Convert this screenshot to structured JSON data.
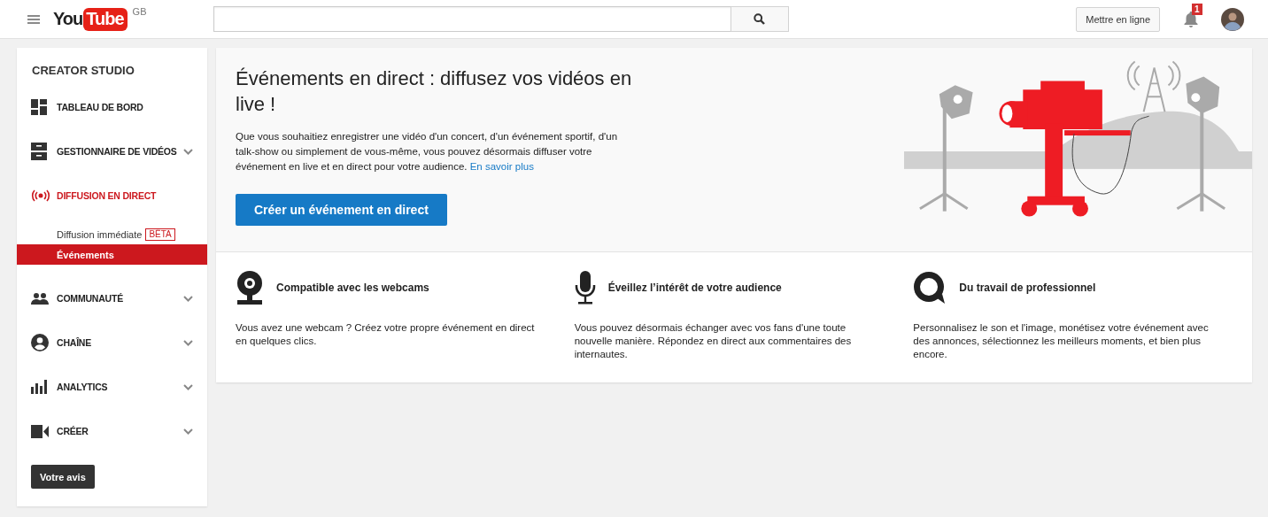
{
  "header": {
    "logo": {
      "you": "You",
      "tube": "Tube"
    },
    "region": "GB",
    "upload_button": "Mettre en ligne",
    "notifications": {
      "count": "1"
    }
  },
  "sidebar": {
    "title": "CREATOR STUDIO",
    "items": [
      {
        "label": "TABLEAU DE BORD",
        "selected": false
      },
      {
        "label": "GESTIONNAIRE DE VIDÉOS",
        "selected": false,
        "expanded": false
      },
      {
        "label": "DIFFUSION EN DIRECT",
        "selected": true,
        "expanded": true,
        "children": [
          {
            "label": "Diffusion immédiate",
            "badge": "BÊTA",
            "selected": false
          },
          {
            "label": "Événements",
            "selected": true
          }
        ]
      },
      {
        "label": "COMMUNAUTÉ",
        "selected": false,
        "expanded": false
      },
      {
        "label": "CHAÎNE",
        "selected": false,
        "expanded": false
      },
      {
        "label": "ANALYTICS",
        "selected": false,
        "expanded": false
      },
      {
        "label": "CRÉER",
        "selected": false,
        "expanded": false
      }
    ],
    "feedback_button": "Votre avis"
  },
  "hero": {
    "title": "Événements en direct : diffusez vos vidéos en live !",
    "description": "Que vous souhaitiez enregistrer une vidéo d'un concert, d'un événement sportif, d'un talk-show ou simplement de vous-même, vous pouvez désormais diffuser votre événement en live et en direct pour votre audience.",
    "link": "En savoir plus",
    "button": "Créer un événement en direct"
  },
  "features": [
    {
      "title": "Compatible avec les webcams",
      "text": "Vous avez une webcam ? Créez votre propre événement en direct en quelques clics."
    },
    {
      "title": "Éveillez l’intérêt de votre audience",
      "text": "Vous pouvez désormais échanger avec vos fans d'une toute nouvelle manière. Répondez en direct aux commentaires des internautes."
    },
    {
      "title": "Du travail de professionnel",
      "text": "Personnalisez le son et l'image, monétisez votre événement avec des annonces, sélectionnez les meilleurs moments, et bien plus encore."
    }
  ]
}
